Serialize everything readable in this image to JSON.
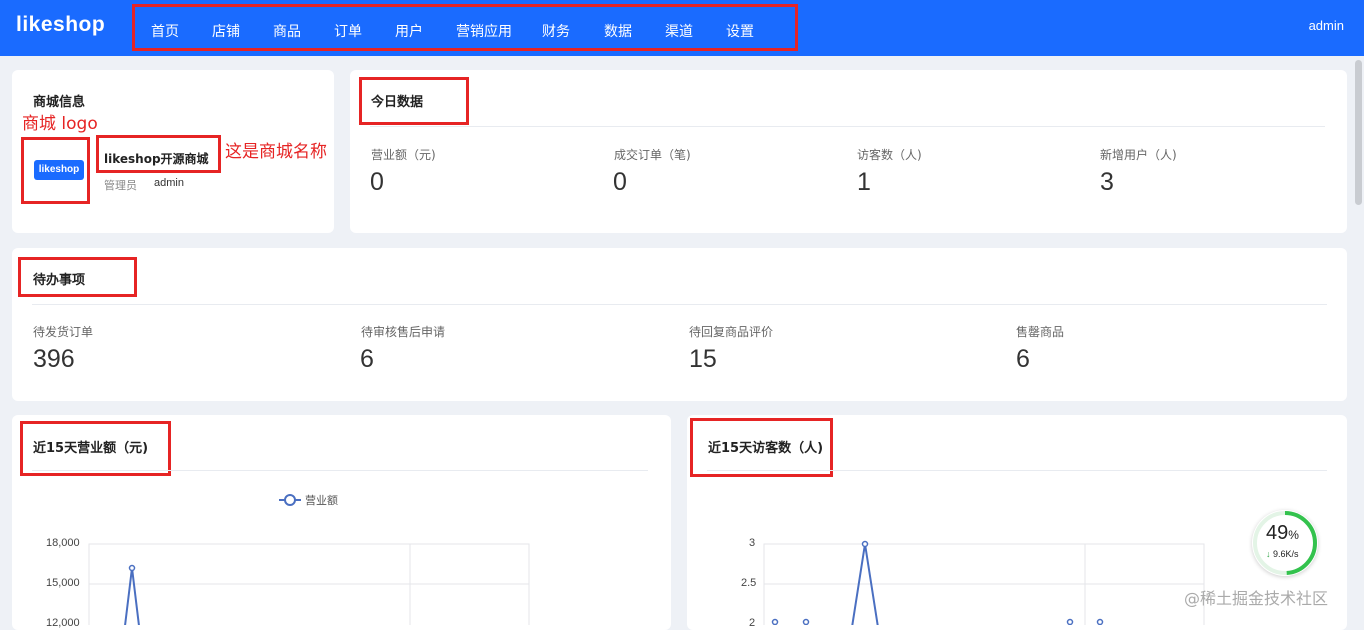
{
  "brand": {
    "logo": "likeshop",
    "accent": "#1a6bff",
    "annotation_color": "#e62424"
  },
  "nav": {
    "items": [
      "首页",
      "店铺",
      "商品",
      "订单",
      "用户",
      "营销应用",
      "财务",
      "数据",
      "渠道",
      "设置"
    ]
  },
  "user": {
    "name": "admin"
  },
  "shop_info": {
    "title": "商城信息",
    "logo_note": "商城 logo",
    "logo_text": "likeshop",
    "name": "likeshop开源商城",
    "name_note": "这是商城名称",
    "manager_label": "管理员",
    "manager_value": "admin"
  },
  "today": {
    "title": "今日数据",
    "stats": [
      {
        "label": "营业额（元)",
        "value": "0"
      },
      {
        "label": "成交订单（笔)",
        "value": "0"
      },
      {
        "label": "访客数（人)",
        "value": "1"
      },
      {
        "label": "新增用户（人)",
        "value": "3"
      }
    ]
  },
  "todo": {
    "title": "待办事项",
    "items": [
      {
        "label": "待发货订单",
        "value": "396"
      },
      {
        "label": "待审核售后申请",
        "value": "6"
      },
      {
        "label": "待回复商品评价",
        "value": "15"
      },
      {
        "label": "售罄商品",
        "value": "6"
      }
    ]
  },
  "revenue_chart_title": "近15天营业额（元)",
  "visitor_chart_title": "近15天访客数（人)",
  "chart_data": [
    {
      "type": "line",
      "title": "近15天营业额（元)",
      "series": [
        {
          "name": "营业额",
          "values": [
            16200
          ],
          "color": "#4a6fc1"
        }
      ],
      "y_ticks": [
        "18,000",
        "15,000",
        "12,000"
      ],
      "ylim": [
        12000,
        18000
      ],
      "legend": "top-center",
      "grid": true
    },
    {
      "type": "line",
      "title": "近15天访客数（人)",
      "series": [
        {
          "values": [
            0,
            0,
            3,
            0,
            0
          ],
          "color": "#4a6fc1"
        }
      ],
      "y_ticks": [
        "3",
        "2.5",
        "2"
      ],
      "ylim": [
        2,
        3
      ],
      "grid": true
    }
  ],
  "speed_widget": {
    "percent": "49",
    "unit": "%",
    "speed": "9.6K/s"
  },
  "watermark": "@稀土掘金技术社区"
}
